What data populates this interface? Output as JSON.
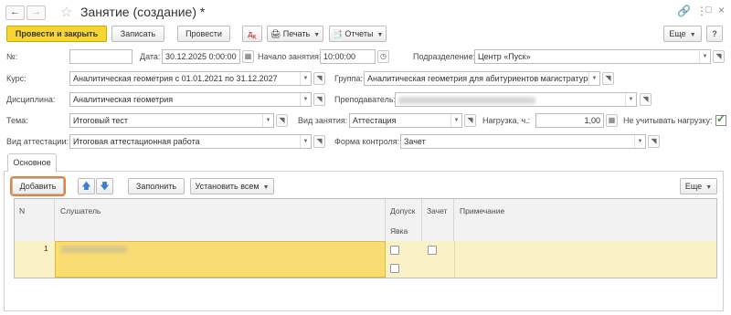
{
  "window": {
    "title": "Занятие (создание) *",
    "back_icon": "arrow-left-icon",
    "forward_icon": "arrow-right-icon",
    "link_icon": "link-icon",
    "more_icon": "vertical-dots-icon",
    "maximize_icon": "maximize-icon",
    "close_icon": "close-icon"
  },
  "toolbar": {
    "post_close": "Провести и закрыть",
    "save": "Записать",
    "post": "Провести",
    "print": "Печать",
    "reports": "Отчеты",
    "more": "Еще"
  },
  "form": {
    "number_label": "№:",
    "number_value": "",
    "date_label": "Дата:",
    "date_value": "30.12.2025  0:00:00",
    "start_label": "Начало занятия:",
    "start_value": "10:00:00",
    "division_label": "Подразделение:",
    "division_value": "Центр «Пуск»",
    "course_label": "Курс:",
    "course_value": "Аналитическая геометрия с 01.01.2021 по 31.12.2027",
    "group_label": "Группа:",
    "group_value": "Аналитическая геометрия для абитуриентов магистратуры",
    "discipline_label": "Дисциплина:",
    "discipline_value": "Аналитическая геометрия",
    "teacher_label": "Преподаватель:",
    "topic_label": "Тема:",
    "topic_value": "Итоговый тест",
    "lesson_type_label": "Вид занятия:",
    "lesson_type_value": "Аттестация",
    "load_label": "Нагрузка, ч.:",
    "load_value": "1,00",
    "ignore_load_label": "Не учитывать нагрузку:",
    "ignore_load_checked": true,
    "attestation_label": "Вид аттестации:",
    "attestation_value": "Итоговая аттестационная работа",
    "control_label": "Форма контроля:",
    "control_value": "Зачет"
  },
  "tabs": {
    "main": "Основное"
  },
  "table_toolbar": {
    "add": "Добавить",
    "up_icon": "arrow-up-icon",
    "down_icon": "arrow-down-icon",
    "fill": "Заполнить",
    "set_all": "Установить всем",
    "more": "Еще"
  },
  "table": {
    "headers": {
      "n": "N",
      "student": "Слушатель",
      "admission": "Допуск",
      "attendance": "Явка",
      "pass": "Зачет",
      "note": "Примечание"
    },
    "rows": [
      {
        "n": "1",
        "admission": false,
        "attendance": false,
        "pass": false,
        "note": ""
      }
    ]
  }
}
